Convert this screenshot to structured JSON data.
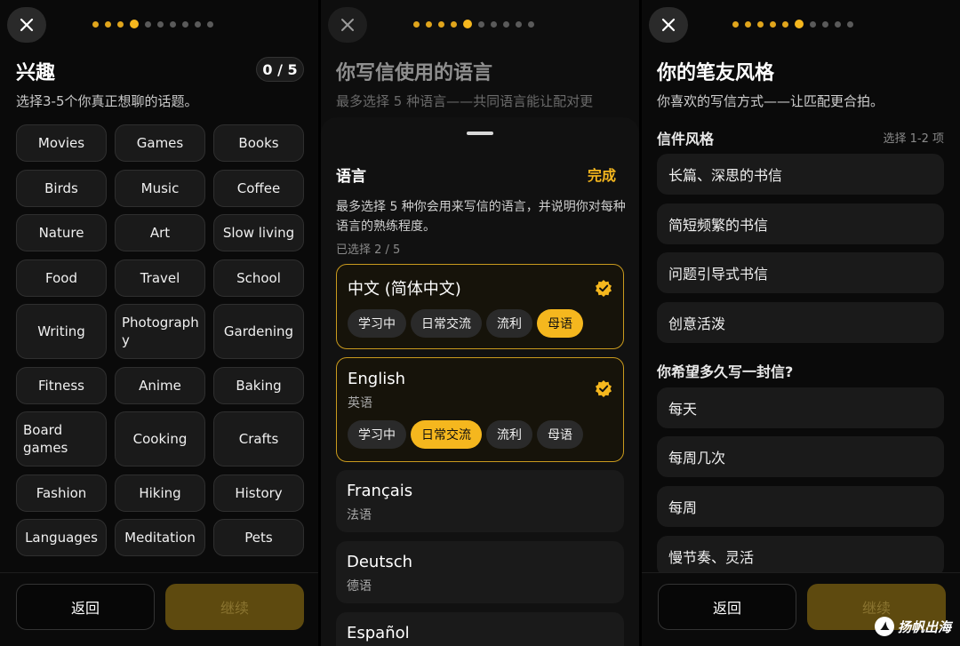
{
  "colors": {
    "accent": "#f5b71e",
    "accent_dim": "#5e4a0f",
    "bg": "#0a0a0a",
    "card": "#1a1a1a"
  },
  "interests": {
    "title": "兴趣",
    "count": "0 / 5",
    "subtitle": "选择3-5个你真正想聊的话题。",
    "tags": [
      "Movies",
      "Games",
      "Books",
      "Birds",
      "Music",
      "Coffee",
      "Nature",
      "Art",
      "Slow living",
      "Food",
      "Travel",
      "School",
      "Writing",
      "Photograph\ny",
      "Gardening",
      "Fitness",
      "Anime",
      "Baking",
      "Board\ngames",
      "Cooking",
      "Crafts",
      "Fashion",
      "Hiking",
      "History",
      "Languages",
      "Meditation",
      "Pets"
    ],
    "back_label": "返回",
    "continue_label": "继续"
  },
  "languages": {
    "title": "你写信使用的语言",
    "subtitle": "最多选择 5 种语言——共同语言能让配对更",
    "sheet_title": "语言",
    "done_label": "完成",
    "sheet_desc": "最多选择 5 种你会用来写信的语言，并说明你对每种语言的熟练程度。",
    "selected": "已选择 2 / 5",
    "levels": [
      "学习中",
      "日常交流",
      "流利",
      "母语"
    ],
    "items": [
      {
        "name": "中文 (简体中文)",
        "native": "",
        "selected": true,
        "level": "母语"
      },
      {
        "name": "English",
        "native": "英语",
        "selected": true,
        "level": "日常交流"
      },
      {
        "name": "Français",
        "native": "法语",
        "selected": false
      },
      {
        "name": "Deutsch",
        "native": "德语",
        "selected": false
      },
      {
        "name": "Español",
        "native": "",
        "selected": false
      }
    ]
  },
  "style": {
    "title": "你的笔友风格",
    "subtitle": "你喜欢的写信方式——让匹配更合拍。",
    "letter_style_label": "信件风格",
    "letter_style_hint": "选择 1-2 项",
    "letter_styles": [
      "长篇、深思的书信",
      "简短频繁的书信",
      "问题引导式书信",
      "创意活泼"
    ],
    "frequency_label": "你希望多久写一封信?",
    "frequencies": [
      "每天",
      "每周几次",
      "每周",
      "慢节奏、灵活"
    ],
    "back_label": "返回",
    "continue_label": "继续"
  },
  "watermark": "扬帆出海"
}
